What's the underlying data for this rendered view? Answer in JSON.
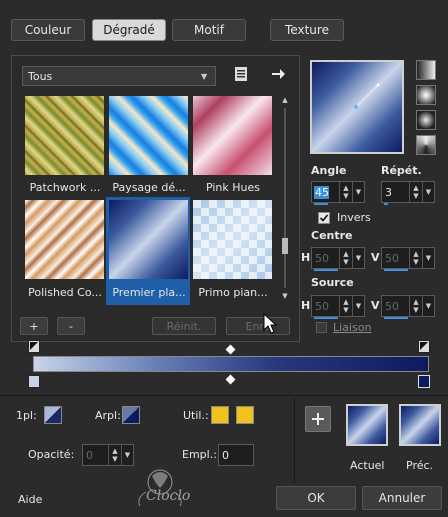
{
  "tabs": [
    {
      "label": "Couleur",
      "active": false
    },
    {
      "label": "Dégradé",
      "active": true
    },
    {
      "label": "Motif",
      "active": false
    },
    {
      "label": "Texture",
      "active": false
    }
  ],
  "category_select": {
    "value": "Tous"
  },
  "gradients": [
    {
      "label": "Patchwork ...",
      "selected": false
    },
    {
      "label": "Paysage dé...",
      "selected": false
    },
    {
      "label": "Pink Hues",
      "selected": false
    },
    {
      "label": "Polished Co...",
      "selected": false
    },
    {
      "label": "Premier pla...",
      "selected": true
    },
    {
      "label": "Primo pian...",
      "selected": false
    }
  ],
  "buttons": {
    "add": "+",
    "remove": "-",
    "reset": "Réinit.",
    "save": "Enre",
    "ok": "OK",
    "cancel": "Annuler",
    "help": "Aide"
  },
  "angle": {
    "label": "Angle",
    "value": "45"
  },
  "repeat": {
    "label": "Répét.",
    "value": "3"
  },
  "invert": {
    "label": "Invers",
    "checked": true
  },
  "center": {
    "label": "Centre",
    "h_label": "H",
    "h": "50",
    "v_label": "V",
    "v": "50"
  },
  "source": {
    "label": "Source",
    "h_label": "H",
    "h": "50",
    "v_label": "V",
    "v": "50"
  },
  "link": {
    "label": "Liaison",
    "checked": false
  },
  "bottom": {
    "fg_label": "1pl:",
    "bg_label": "Arpl:",
    "used_label": "Util.:",
    "opacity_label": "Opacité:",
    "opacity_value": "0",
    "location_label": "Empl.:",
    "location_value": "0",
    "current_label": "Actuel",
    "previous_label": "Préc."
  },
  "watermark": "Cloclo",
  "colors": {
    "accent": "#3a8fd8",
    "gradient_light": "#c8d4ea",
    "gradient_dark": "#0d1a5e",
    "used_swatch": "#f1c21b"
  }
}
